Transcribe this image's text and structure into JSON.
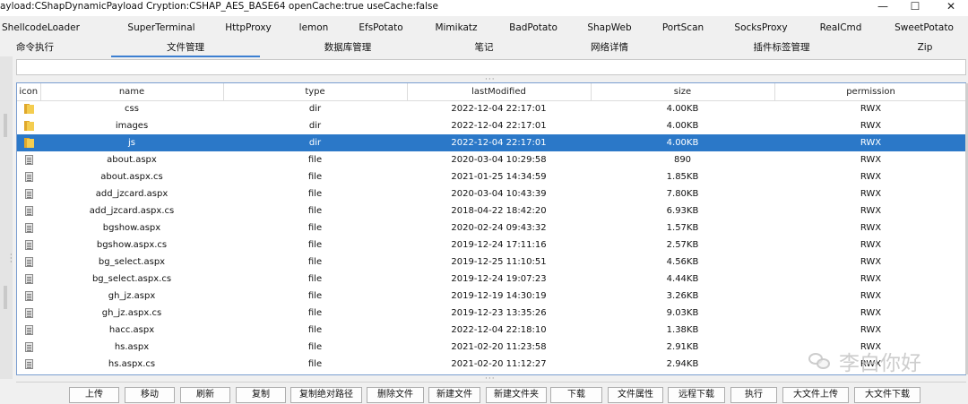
{
  "window": {
    "title": "ayload:CShapDynamicPayload Cryption:CSHAP_AES_BASE64 openCache:true useCache:false",
    "minimize": "—",
    "maximize": "☐",
    "close": "✕"
  },
  "plugin_tabs": [
    "ShellcodeLoader",
    "SuperTerminal",
    "HttpProxy",
    "lemon",
    "EfsPotato",
    "Mimikatz",
    "BadPotato",
    "ShapWeb",
    "PortScan",
    "SocksProxy",
    "RealCmd",
    "SweetPotato"
  ],
  "main_tabs": [
    "命令执行",
    "文件管理",
    "数据库管理",
    "笔记",
    "网络详情",
    "插件标签管理",
    "Zip"
  ],
  "active_main_tab": "文件管理",
  "path_input": {
    "value": ""
  },
  "file_table": {
    "columns": [
      "icon",
      "name",
      "type",
      "lastModified",
      "size",
      "permission"
    ],
    "rows": [
      {
        "icon": "folder-icon",
        "name": "css",
        "type": "dir",
        "lastModified": "2022-12-04 22:17:01",
        "size": "4.00KB",
        "permission": "RWX"
      },
      {
        "icon": "folder-icon",
        "name": "images",
        "type": "dir",
        "lastModified": "2022-12-04 22:17:01",
        "size": "4.00KB",
        "permission": "RWX"
      },
      {
        "icon": "folder-icon",
        "name": "js",
        "type": "dir",
        "lastModified": "2022-12-04 22:17:01",
        "size": "4.00KB",
        "permission": "RWX"
      },
      {
        "icon": "file-icon",
        "name": "about.aspx",
        "type": "file",
        "lastModified": "2020-03-04 10:29:58",
        "size": "890",
        "permission": "RWX"
      },
      {
        "icon": "file-icon",
        "name": "about.aspx.cs",
        "type": "file",
        "lastModified": "2021-01-25 14:34:59",
        "size": "1.85KB",
        "permission": "RWX"
      },
      {
        "icon": "file-icon",
        "name": "add_jzcard.aspx",
        "type": "file",
        "lastModified": "2020-03-04 10:43:39",
        "size": "7.80KB",
        "permission": "RWX"
      },
      {
        "icon": "file-icon",
        "name": "add_jzcard.aspx.cs",
        "type": "file",
        "lastModified": "2018-04-22 18:42:20",
        "size": "6.93KB",
        "permission": "RWX"
      },
      {
        "icon": "file-icon",
        "name": "bgshow.aspx",
        "type": "file",
        "lastModified": "2020-02-24 09:43:32",
        "size": "1.57KB",
        "permission": "RWX"
      },
      {
        "icon": "file-icon",
        "name": "bgshow.aspx.cs",
        "type": "file",
        "lastModified": "2019-12-24 17:11:16",
        "size": "2.57KB",
        "permission": "RWX"
      },
      {
        "icon": "file-icon",
        "name": "bg_select.aspx",
        "type": "file",
        "lastModified": "2019-12-25 11:10:51",
        "size": "4.56KB",
        "permission": "RWX"
      },
      {
        "icon": "file-icon",
        "name": "bg_select.aspx.cs",
        "type": "file",
        "lastModified": "2019-12-24 19:07:23",
        "size": "4.44KB",
        "permission": "RWX"
      },
      {
        "icon": "file-icon",
        "name": "gh_jz.aspx",
        "type": "file",
        "lastModified": "2019-12-19 14:30:19",
        "size": "3.26KB",
        "permission": "RWX"
      },
      {
        "icon": "file-icon",
        "name": "gh_jz.aspx.cs",
        "type": "file",
        "lastModified": "2019-12-23 13:35:26",
        "size": "9.03KB",
        "permission": "RWX"
      },
      {
        "icon": "file-icon",
        "name": "hacc.aspx",
        "type": "file",
        "lastModified": "2022-12-04 22:18:10",
        "size": "1.38KB",
        "permission": "RWX"
      },
      {
        "icon": "file-icon",
        "name": "hs.aspx",
        "type": "file",
        "lastModified": "2021-02-20 11:23:58",
        "size": "2.91KB",
        "permission": "RWX"
      },
      {
        "icon": "file-icon",
        "name": "hs.aspx.cs",
        "type": "file",
        "lastModified": "2021-02-20 11:12:27",
        "size": "2.94KB",
        "permission": "RWX"
      }
    ],
    "selected_row": 2
  },
  "action_buttons": [
    "上传",
    "移动",
    "刷新",
    "复制",
    "复制绝对路径",
    "删除文件",
    "新建文件",
    "新建文件夹",
    "下载",
    "文件属性",
    "远程下载",
    "执行",
    "大文件上传",
    "大文件下载"
  ],
  "watermark": "李白你好"
}
